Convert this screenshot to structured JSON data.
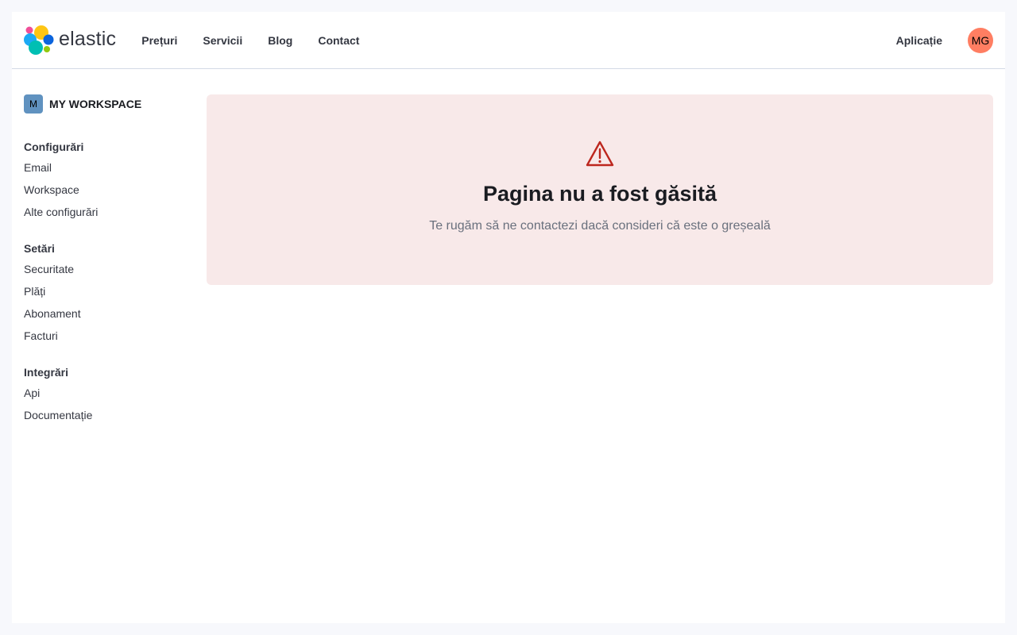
{
  "brand": {
    "name": "elastic",
    "colors": [
      "#f04e98",
      "#fec514",
      "#00bfb3",
      "#1ba9f5",
      "#0b64dd",
      "#93c90e"
    ]
  },
  "nav": {
    "items": [
      "Prețuri",
      "Servicii",
      "Blog",
      "Contact"
    ]
  },
  "header": {
    "app_link": "Aplicație",
    "avatar_initials": "MG",
    "avatar_color": "#ff7e62"
  },
  "workspace": {
    "badge": "M",
    "name": "MY WORKSPACE"
  },
  "sidebar": {
    "groups": [
      {
        "title": "Configurări",
        "items": [
          "Email",
          "Workspace",
          "Alte configurări"
        ]
      },
      {
        "title": "Setări",
        "items": [
          "Securitate",
          "Plăți",
          "Abonament",
          "Facturi"
        ]
      },
      {
        "title": "Integrări",
        "items": [
          "Api",
          "Documentație"
        ]
      }
    ]
  },
  "error": {
    "icon": "warning-icon",
    "title": "Pagina nu a fost găsită",
    "message": "Te rugăm să ne contactezi dacă consideri că este o greșeală",
    "background": "#f8e9e9",
    "icon_color": "#bd271e"
  }
}
